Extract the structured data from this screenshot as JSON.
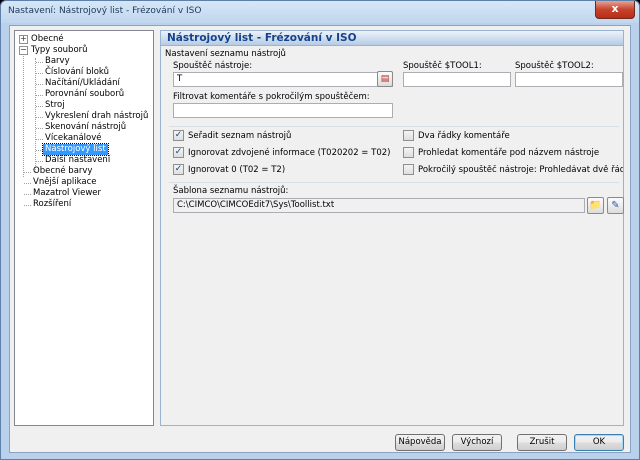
{
  "window": {
    "title": "Nastavení: Nástrojový list - Frézování v ISO",
    "close_glyph": "x"
  },
  "tree": {
    "items": [
      {
        "label": "Obecné",
        "toggle": "+"
      },
      {
        "label": "Typy souborů",
        "toggle": "−"
      },
      {
        "label": "Barvy"
      },
      {
        "label": "Číslování bloků"
      },
      {
        "label": "Načítání/Ukládání"
      },
      {
        "label": "Porovnání souborů"
      },
      {
        "label": "Stroj"
      },
      {
        "label": "Vykreslení drah nástrojů"
      },
      {
        "label": "Skenování nástrojů"
      },
      {
        "label": "Vícekanálové"
      },
      {
        "label": "Nástrojový list",
        "selected": true
      },
      {
        "label": "Další nastavení"
      },
      {
        "label": "Obecné barvy"
      },
      {
        "label": "Vnější aplikace"
      },
      {
        "label": "Mazatrol Viewer"
      },
      {
        "label": "Rozšíření"
      }
    ]
  },
  "panel": {
    "title": "Nástrojový list - Frézování v ISO",
    "group_label": "Nastavení seznamu nástrojů",
    "tool_trigger_label": "Spouštěč nástroje:",
    "tool_trigger_value": "T",
    "tool1_label": "Spouštěč $TOOL1:",
    "tool1_value": "",
    "tool2_label": "Spouštěč $TOOL2:",
    "tool2_value": "",
    "filter_label": "Filtrovat komentáře s pokročilým spouštěčem:",
    "filter_value": "",
    "checkboxes_left": [
      {
        "label": "Seřadit seznam nástrojů",
        "checked": true
      },
      {
        "label": "Ignorovat zdvojené informace (T020202 = T02)",
        "checked": true
      },
      {
        "label": "Ignorovat 0 (T02 = T2)",
        "checked": true
      }
    ],
    "checkboxes_right": [
      {
        "label": "Dva řádky komentáře",
        "checked": false
      },
      {
        "label": "Prohledat komentáře pod názvem nástroje",
        "checked": false
      },
      {
        "label": "Pokročilý spouštěč nástroje: Prohledávat dvě řádky najednou",
        "checked": false
      }
    ],
    "template_label": "Šablona seznamu nástrojů:",
    "template_value": "C:\\CIMCO\\CIMCOEdit7\\Sys\\Toollist.txt",
    "check_glyph": "✓"
  },
  "buttons": {
    "help": "Nápověda",
    "default": "Výchozí",
    "cancel": "Zrušit",
    "ok": "OK"
  }
}
